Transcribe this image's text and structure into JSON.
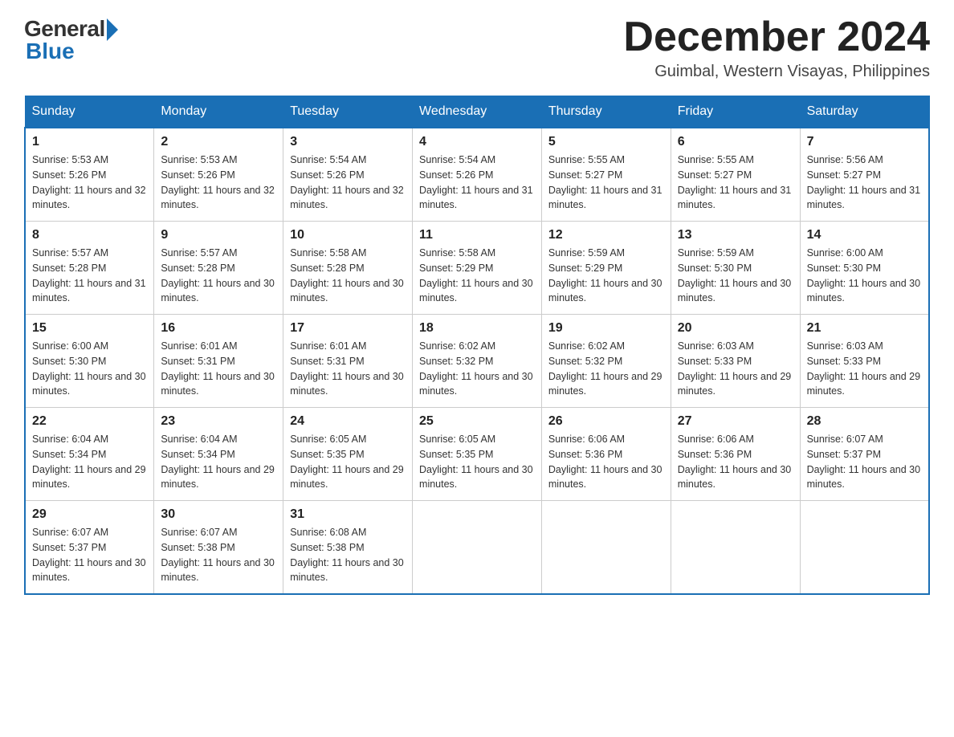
{
  "header": {
    "logo_general": "General",
    "logo_blue": "Blue",
    "month_title": "December 2024",
    "location": "Guimbal, Western Visayas, Philippines"
  },
  "days_of_week": [
    "Sunday",
    "Monday",
    "Tuesday",
    "Wednesday",
    "Thursday",
    "Friday",
    "Saturday"
  ],
  "weeks": [
    [
      {
        "day": "1",
        "sunrise": "5:53 AM",
        "sunset": "5:26 PM",
        "daylight": "11 hours and 32 minutes."
      },
      {
        "day": "2",
        "sunrise": "5:53 AM",
        "sunset": "5:26 PM",
        "daylight": "11 hours and 32 minutes."
      },
      {
        "day": "3",
        "sunrise": "5:54 AM",
        "sunset": "5:26 PM",
        "daylight": "11 hours and 32 minutes."
      },
      {
        "day": "4",
        "sunrise": "5:54 AM",
        "sunset": "5:26 PM",
        "daylight": "11 hours and 31 minutes."
      },
      {
        "day": "5",
        "sunrise": "5:55 AM",
        "sunset": "5:27 PM",
        "daylight": "11 hours and 31 minutes."
      },
      {
        "day": "6",
        "sunrise": "5:55 AM",
        "sunset": "5:27 PM",
        "daylight": "11 hours and 31 minutes."
      },
      {
        "day": "7",
        "sunrise": "5:56 AM",
        "sunset": "5:27 PM",
        "daylight": "11 hours and 31 minutes."
      }
    ],
    [
      {
        "day": "8",
        "sunrise": "5:57 AM",
        "sunset": "5:28 PM",
        "daylight": "11 hours and 31 minutes."
      },
      {
        "day": "9",
        "sunrise": "5:57 AM",
        "sunset": "5:28 PM",
        "daylight": "11 hours and 30 minutes."
      },
      {
        "day": "10",
        "sunrise": "5:58 AM",
        "sunset": "5:28 PM",
        "daylight": "11 hours and 30 minutes."
      },
      {
        "day": "11",
        "sunrise": "5:58 AM",
        "sunset": "5:29 PM",
        "daylight": "11 hours and 30 minutes."
      },
      {
        "day": "12",
        "sunrise": "5:59 AM",
        "sunset": "5:29 PM",
        "daylight": "11 hours and 30 minutes."
      },
      {
        "day": "13",
        "sunrise": "5:59 AM",
        "sunset": "5:30 PM",
        "daylight": "11 hours and 30 minutes."
      },
      {
        "day": "14",
        "sunrise": "6:00 AM",
        "sunset": "5:30 PM",
        "daylight": "11 hours and 30 minutes."
      }
    ],
    [
      {
        "day": "15",
        "sunrise": "6:00 AM",
        "sunset": "5:30 PM",
        "daylight": "11 hours and 30 minutes."
      },
      {
        "day": "16",
        "sunrise": "6:01 AM",
        "sunset": "5:31 PM",
        "daylight": "11 hours and 30 minutes."
      },
      {
        "day": "17",
        "sunrise": "6:01 AM",
        "sunset": "5:31 PM",
        "daylight": "11 hours and 30 minutes."
      },
      {
        "day": "18",
        "sunrise": "6:02 AM",
        "sunset": "5:32 PM",
        "daylight": "11 hours and 30 minutes."
      },
      {
        "day": "19",
        "sunrise": "6:02 AM",
        "sunset": "5:32 PM",
        "daylight": "11 hours and 29 minutes."
      },
      {
        "day": "20",
        "sunrise": "6:03 AM",
        "sunset": "5:33 PM",
        "daylight": "11 hours and 29 minutes."
      },
      {
        "day": "21",
        "sunrise": "6:03 AM",
        "sunset": "5:33 PM",
        "daylight": "11 hours and 29 minutes."
      }
    ],
    [
      {
        "day": "22",
        "sunrise": "6:04 AM",
        "sunset": "5:34 PM",
        "daylight": "11 hours and 29 minutes."
      },
      {
        "day": "23",
        "sunrise": "6:04 AM",
        "sunset": "5:34 PM",
        "daylight": "11 hours and 29 minutes."
      },
      {
        "day": "24",
        "sunrise": "6:05 AM",
        "sunset": "5:35 PM",
        "daylight": "11 hours and 29 minutes."
      },
      {
        "day": "25",
        "sunrise": "6:05 AM",
        "sunset": "5:35 PM",
        "daylight": "11 hours and 30 minutes."
      },
      {
        "day": "26",
        "sunrise": "6:06 AM",
        "sunset": "5:36 PM",
        "daylight": "11 hours and 30 minutes."
      },
      {
        "day": "27",
        "sunrise": "6:06 AM",
        "sunset": "5:36 PM",
        "daylight": "11 hours and 30 minutes."
      },
      {
        "day": "28",
        "sunrise": "6:07 AM",
        "sunset": "5:37 PM",
        "daylight": "11 hours and 30 minutes."
      }
    ],
    [
      {
        "day": "29",
        "sunrise": "6:07 AM",
        "sunset": "5:37 PM",
        "daylight": "11 hours and 30 minutes."
      },
      {
        "day": "30",
        "sunrise": "6:07 AM",
        "sunset": "5:38 PM",
        "daylight": "11 hours and 30 minutes."
      },
      {
        "day": "31",
        "sunrise": "6:08 AM",
        "sunset": "5:38 PM",
        "daylight": "11 hours and 30 minutes."
      },
      null,
      null,
      null,
      null
    ]
  ]
}
